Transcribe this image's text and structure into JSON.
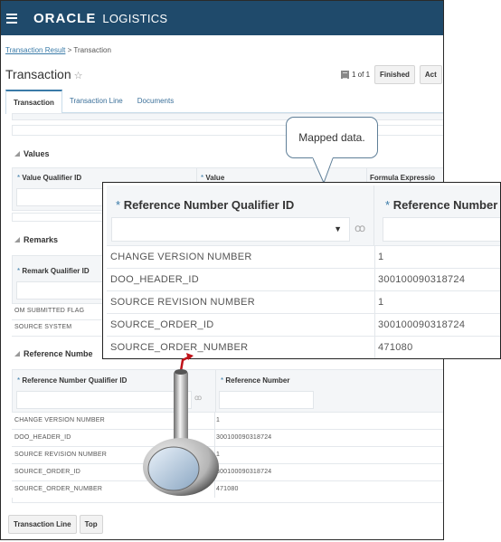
{
  "app": {
    "brand": "ORACLE",
    "product": "LOGISTICS"
  },
  "breadcrumb": {
    "link": "Transaction Result",
    "separator": ">",
    "current": "Transaction"
  },
  "page": {
    "title": "Transaction",
    "favorite_icon": "star-outline-icon"
  },
  "pager": {
    "text": "1 of 1",
    "finished_label": "Finished",
    "actions_label": "Act"
  },
  "tabs": [
    {
      "label": "Transaction",
      "active": true
    },
    {
      "label": "Transaction Line",
      "active": false
    },
    {
      "label": "Documents",
      "active": false
    }
  ],
  "values_section": {
    "title": "Values",
    "columns": [
      "Value Qualifier ID",
      "Value",
      "Formula Expressio"
    ]
  },
  "remarks_section": {
    "title": "Remarks",
    "column": "Remark Qualifier ID",
    "rows": [
      "OM SUBMITTED FLAG",
      "SOURCE SYSTEM"
    ]
  },
  "reference_section": {
    "title": "Reference Numbe",
    "columns": [
      "Reference Number Qualifier ID",
      "Reference Number"
    ],
    "rows": [
      {
        "qualifier": "CHANGE VERSION NUMBER",
        "value": "1"
      },
      {
        "qualifier": "DOO_HEADER_ID",
        "value": "300100090318724"
      },
      {
        "qualifier": "SOURCE REVISION NUMBER",
        "value": "1"
      },
      {
        "qualifier": "SOURCE_ORDER_ID",
        "value": "300100090318724"
      },
      {
        "qualifier": "SOURCE_ORDER_NUMBER",
        "value": "471080"
      }
    ]
  },
  "zoom_panel": {
    "columns": [
      "Reference Number Qualifier ID",
      "Reference Number"
    ],
    "rows": [
      {
        "qualifier": "CHANGE VERSION NUMBER",
        "value": "1"
      },
      {
        "qualifier": "DOO_HEADER_ID",
        "value": "300100090318724"
      },
      {
        "qualifier": "SOURCE REVISION NUMBER",
        "value": "1"
      },
      {
        "qualifier": "SOURCE_ORDER_ID",
        "value": "300100090318724"
      },
      {
        "qualifier": "SOURCE_ORDER_NUMBER",
        "value": "471080"
      }
    ]
  },
  "callout": {
    "text": "Mapped data."
  },
  "required_marker": "*",
  "dropdown_glyph": "▼",
  "bottom_buttons": {
    "transaction_line": "Transaction Line",
    "top": "Top"
  },
  "colors": {
    "header_bg": "#1f4a6b",
    "link": "#3a7ba8",
    "arrow": "#c0141a"
  }
}
